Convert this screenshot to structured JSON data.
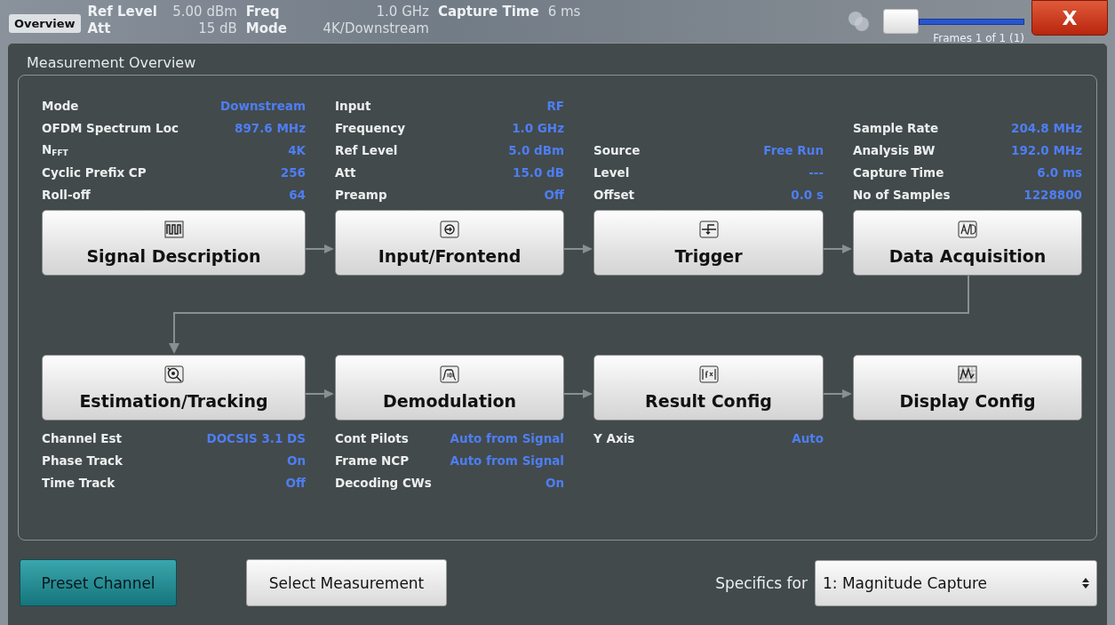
{
  "header": {
    "tab": "Overview",
    "rows": [
      [
        {
          "label": "Ref Level",
          "value": "5.00 dBm"
        },
        {
          "label": "Freq",
          "value": "1.0 GHz"
        },
        {
          "label": "Capture Time",
          "value": "6 ms"
        }
      ],
      [
        {
          "label": "Att",
          "value": "15 dB"
        },
        {
          "label": "Mode",
          "value": "4K/Downstream"
        }
      ]
    ],
    "frames": "Frames 1 of 1 (1)",
    "close": "X"
  },
  "dialog": {
    "title": "Measurement Overview"
  },
  "flow_rows": [
    {
      "stages": [
        {
          "title": "Signal Description",
          "settings": [
            {
              "label": "Mode",
              "value": "Downstream"
            },
            {
              "label": "OFDM Spectrum Loc",
              "value": "897.6 MHz"
            },
            {
              "label": "N$_{FFT}$",
              "value": "4K"
            },
            {
              "label": "Cyclic Prefix CP",
              "value": "256"
            },
            {
              "label": "Roll-off",
              "value": "64"
            }
          ]
        },
        {
          "title": "Input/Frontend",
          "settings": [
            {
              "label": "Input",
              "value": "RF"
            },
            {
              "label": "Frequency",
              "value": "1.0 GHz"
            },
            {
              "label": "Ref Level",
              "value": "5.0 dBm"
            },
            {
              "label": "Att",
              "value": "15.0 dB"
            },
            {
              "label": "Preamp",
              "value": "Off"
            }
          ]
        },
        {
          "title": "Trigger",
          "settings": [
            {
              "label": "Source",
              "value": "Free Run"
            },
            {
              "label": "Level",
              "value": "---"
            },
            {
              "label": "Offset",
              "value": "0.0 s"
            }
          ]
        },
        {
          "title": "Data Acquisition",
          "settings": [
            {
              "label": "Sample Rate",
              "value": "204.8 MHz"
            },
            {
              "label": "Analysis BW",
              "value": "192.0 MHz"
            },
            {
              "label": "Capture Time",
              "value": "6.0 ms"
            },
            {
              "label": "No of Samples",
              "value": "1228800"
            }
          ]
        }
      ]
    },
    {
      "stages": [
        {
          "title": "Estimation/Tracking",
          "settings": [
            {
              "label": "Channel Est",
              "value": "DOCSIS 3.1 DS"
            },
            {
              "label": "Phase Track",
              "value": "On"
            },
            {
              "label": "Time Track",
              "value": "Off"
            }
          ]
        },
        {
          "title": "Demodulation",
          "settings": [
            {
              "label": "Cont Pilots",
              "value": "Auto from Signal"
            },
            {
              "label": "Frame NCP",
              "value": "Auto from Signal"
            },
            {
              "label": "Decoding CWs",
              "value": "On"
            }
          ]
        },
        {
          "title": "Result Config",
          "settings": [
            {
              "label": "Y Axis",
              "value": "Auto"
            }
          ]
        },
        {
          "title": "Display Config"
        }
      ]
    }
  ],
  "footer": {
    "preset": "Preset Channel",
    "select": "Select Measurement",
    "specifics_label": "Specifics for",
    "specifics_value": "1: Magnitude Capture"
  }
}
